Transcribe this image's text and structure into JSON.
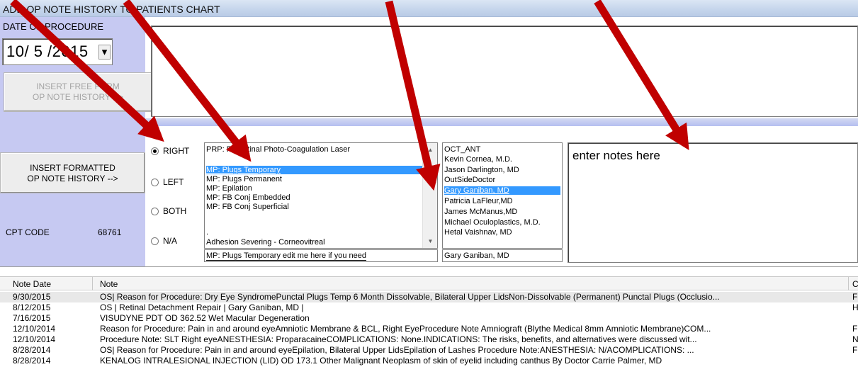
{
  "window": {
    "title": "ADD OP NOTE HISTORY TO PATIENTS CHART"
  },
  "left_panel": {
    "date_label": "DATE OF PROCEDURE",
    "date_value": "10/ 5 /2015",
    "dropdown_glyph": "▾",
    "free_form_button": [
      "INSERT FREE FORM",
      "OP NOTE HISTORY -->"
    ],
    "formatted_button": [
      "INSERT FORMATTED",
      "OP NOTE HISTORY -->"
    ],
    "cpt_label": "CPT CODE",
    "cpt_value": "68761"
  },
  "laterality": {
    "selected": "RIGHT",
    "options": [
      "RIGHT",
      "LEFT",
      "BOTH",
      "N/A"
    ]
  },
  "procedures": {
    "items": [
      "PRP: Panretinal Photo-Coagulation Laser",
      "",
      "MP: Plugs Temporary",
      "MP: Plugs Permanent",
      "MP: Epilation",
      "MP: FB Conj Embedded",
      "MP: FB Conj Superficial",
      "",
      "",
      ".",
      "Adhesion Severing - Corneovitreal"
    ],
    "selected_index": 2,
    "edit_value": "MP: Plugs Temporary edit me here if you need"
  },
  "doctors": {
    "items": [
      "OCT_ANT",
      "Kevin Cornea, M.D.",
      "Jason Darlington, MD",
      "OutSideDoctor",
      "Gary Ganiban, MD",
      "Patricia LaFleur,MD",
      "James McManus,MD",
      "Michael Oculoplastics, M.D.",
      "Hetal Vaishnav, MD"
    ],
    "selected_index": 4,
    "edit_value": "Gary Ganiban, MD"
  },
  "notes": {
    "placeholder": "enter notes here"
  },
  "grid": {
    "columns": [
      "Note Date",
      "Note",
      "C"
    ],
    "rows": [
      {
        "date": "9/30/2015",
        "note": "OS| Reason for Procedure: Dry Eye SyndromePunctal Plugs Temp 6 Month Dissolvable, Bilateral Upper LidsNon-Dissolvable (Permanent) Punctal Plugs (Occlusio...",
        "extra": "F"
      },
      {
        "date": "8/12/2015",
        "note": "OS | Retinal Detachment Repair | Gary Ganiban, MD |",
        "extra": "H"
      },
      {
        "date": "7/16/2015",
        "note": "VISUDYNE PDT OD 362.52 Wet Macular Degeneration",
        "extra": ""
      },
      {
        "date": "12/10/2014",
        "note": "Reason for Procedure: Pain in and around eyeAmniotic Membrane & BCL, Right EyeProcedure Note Amniograft (Blythe Medical 8mm Amniotic Membrane)COM...",
        "extra": "F"
      },
      {
        "date": "12/10/2014",
        "note": "Procedure Note: SLT Right eyeANESTHESIA: ProparacaineCOMPLICATIONS: None.INDICATIONS: The risks, benefits, and alternatives were discussed wit...",
        "extra": "N"
      },
      {
        "date": "8/28/2014",
        "note": "OS| Reason for Procedure: Pain in and around eyeEpilation, Bilateral Upper LidsEpilation of Lashes Procedure Note:ANESTHESIA: N/ACOMPLICATIONS: ...",
        "extra": "F"
      },
      {
        "date": "8/28/2014",
        "note": "KENALOG INTRALESIONAL INJECTION (LID) OD 173.1 Other Malignant Neoplasm of skin of eyelid including canthus By Doctor Carrie Palmer, MD",
        "extra": ""
      }
    ]
  },
  "colors": {
    "panel": "#c6c9f2",
    "selection": "#3399ff",
    "annotation_arrow": "#c00000"
  }
}
